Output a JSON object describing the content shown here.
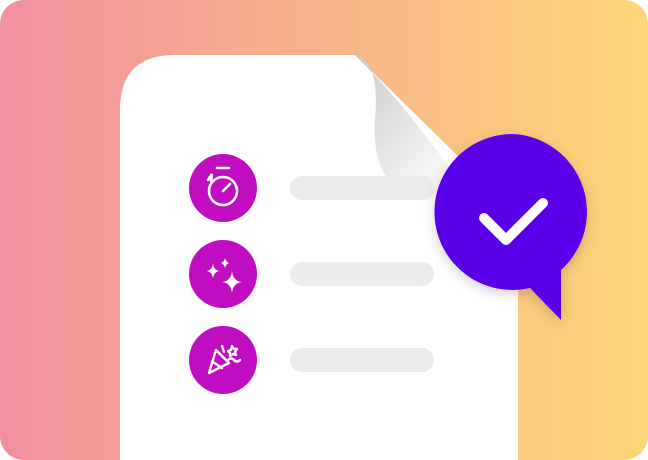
{
  "illustration": {
    "colors": {
      "background_start": "#f2909e",
      "background_end": "#fdd777",
      "icon_circle": "#c10dc2",
      "bubble": "#5a06e9",
      "placeholder_bar": "#ececec"
    },
    "checklist": [
      {
        "icon": "stopwatch-icon"
      },
      {
        "icon": "sparkles-icon"
      },
      {
        "icon": "party-popper-icon"
      }
    ],
    "badge_icon": "checkmark-icon"
  }
}
